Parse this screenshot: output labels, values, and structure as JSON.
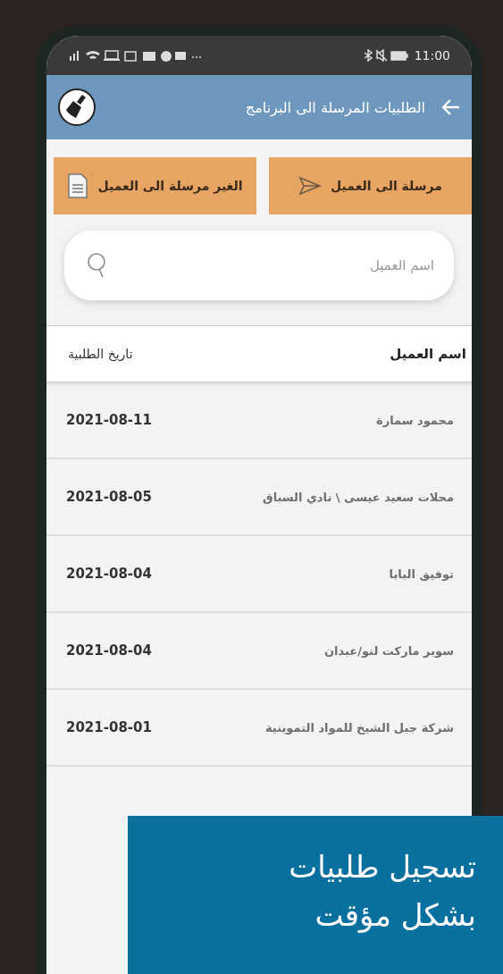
{
  "status_bar": {
    "time": "11:00"
  },
  "app_bar": {
    "title": "الطلبيات المرسلة الى البرنامج"
  },
  "filter_buttons": [
    {
      "label": "مرسلة الى العميل",
      "kind": "send"
    },
    {
      "label": "الغير مرسلة الى العميل",
      "kind": "document"
    }
  ],
  "search": {
    "placeholder": "اسم العميل"
  },
  "table": {
    "columns": [
      "اسم العميل",
      "تاريخ الطلبية"
    ],
    "rows": [
      {
        "customer": "محمود سمارة",
        "date": "2021-08-11"
      },
      {
        "customer": "محلات سعيد عيسى \\ نادي السباق",
        "date": "2021-08-05"
      },
      {
        "customer": "توفيق البابا",
        "date": "2021-08-04"
      },
      {
        "customer": "سوبر ماركت لنو/عبدان",
        "date": "2021-08-04"
      },
      {
        "customer": "شركة جبل الشيخ للمواد التموينية",
        "date": "2021-08-01"
      }
    ]
  },
  "banner": {
    "lines": [
      "تسجيل طلبيات",
      "بشكل مؤقت"
    ]
  }
}
